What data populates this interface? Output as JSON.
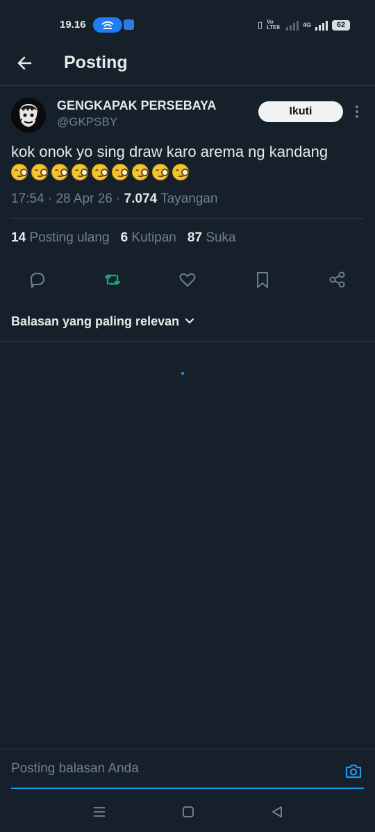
{
  "status_bar": {
    "time": "19.16",
    "network_labels": "Vo LTE8",
    "network_4g": "4G",
    "battery": "62"
  },
  "header": {
    "title": "Posting"
  },
  "post": {
    "author_name": "GENGKAPAK PERSEBAYA",
    "author_handle": "@GKPSBY",
    "follow_label": "Ikuti",
    "text": "kok onok yo sing draw karo arema ng kandang",
    "emoji": "🧐",
    "emoji_count": 9,
    "time": "17:54",
    "date": "28 Apr 26",
    "views": "7.074",
    "views_label": "Tayangan",
    "reposts": "14",
    "reposts_label": "Posting ulang",
    "quotes": "6",
    "quotes_label": "Kutipan",
    "likes": "87",
    "likes_label": "Suka"
  },
  "actions": [
    "reply-icon",
    "repost-icon",
    "like-icon",
    "bookmark-icon",
    "share-icon"
  ],
  "colors": {
    "background": "#16202a",
    "accent": "#1d9bf0",
    "repost_green": "#00ba7c",
    "muted": "#71808e"
  },
  "replies": {
    "sort_label": "Balasan yang paling relevan"
  },
  "composer": {
    "placeholder": "Posting balasan Anda"
  }
}
